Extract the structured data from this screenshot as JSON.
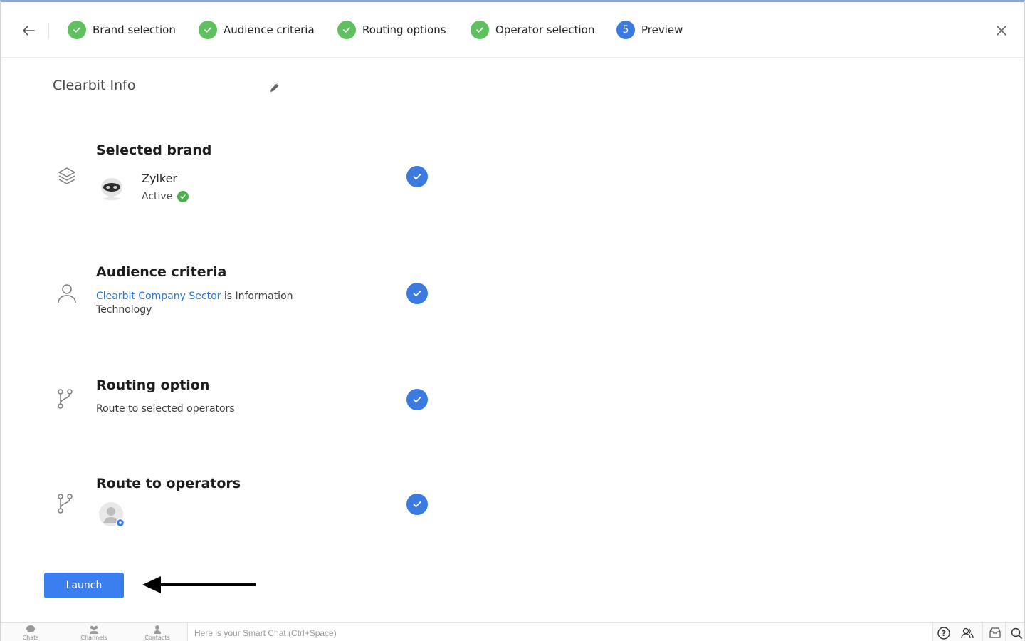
{
  "stepper": {
    "steps": [
      {
        "label": "Brand selection",
        "state": "done"
      },
      {
        "label": "Audience criteria",
        "state": "done"
      },
      {
        "label": "Routing options",
        "state": "done"
      },
      {
        "label": "Operator selection",
        "state": "done"
      },
      {
        "label": "Preview",
        "state": "current",
        "number": "5"
      }
    ]
  },
  "page": {
    "title": "Clearbit Info"
  },
  "sections": {
    "brand": {
      "title": "Selected brand",
      "name": "Zylker",
      "status": "Active"
    },
    "audience": {
      "title": "Audience criteria",
      "criteria_field": "Clearbit Company Sector",
      "criteria_rest": " is Information Technology"
    },
    "routing": {
      "title": "Routing option",
      "text": "Route to selected operators"
    },
    "operators": {
      "title": "Route to operators"
    }
  },
  "actions": {
    "launch_label": "Launch"
  },
  "bottom_bar": {
    "chats_label": "Chats",
    "channels_label": "Channels",
    "contacts_label": "Contacts",
    "smart_chat_placeholder": "Here is your Smart Chat (Ctrl+Space)"
  },
  "colors": {
    "accent": "#3b7ae0",
    "step_done": "#5ec05e",
    "link": "#2d76d2",
    "launch": "#3b7ef0"
  },
  "icons": {
    "back": "arrow-left-icon",
    "close": "close-icon",
    "edit": "pencil-icon",
    "brand": "layers-icon",
    "audience": "user-icon",
    "routing": "branch-icon",
    "operators": "branch-icon"
  }
}
